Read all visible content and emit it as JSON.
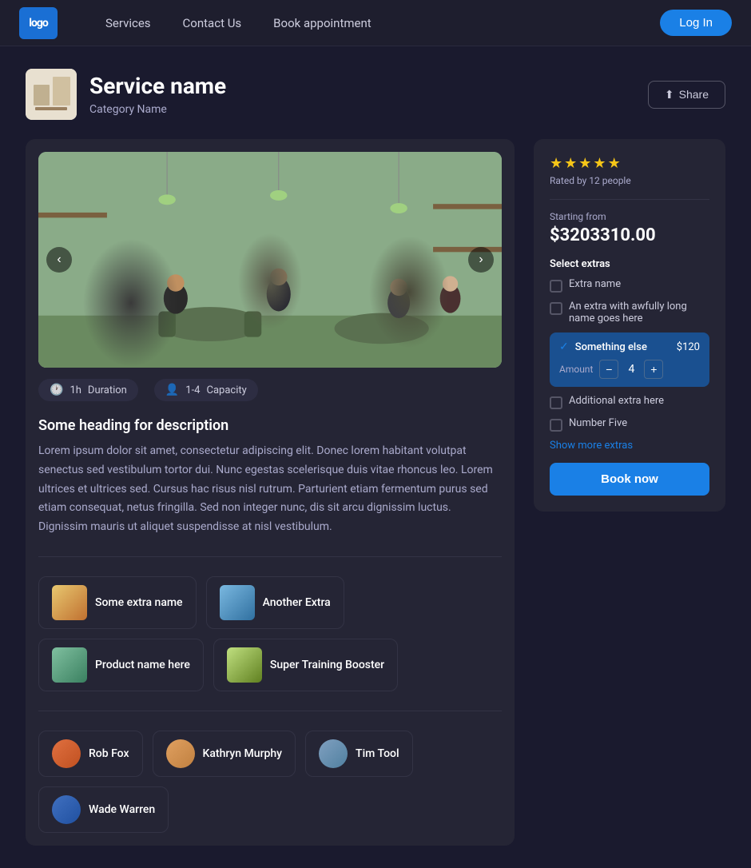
{
  "nav": {
    "logo": "logo",
    "links": [
      {
        "label": "Services",
        "id": "services"
      },
      {
        "label": "Contact Us",
        "id": "contact"
      },
      {
        "label": "Book appointment",
        "id": "book"
      }
    ],
    "login_label": "Log In"
  },
  "service": {
    "name": "Service name",
    "category": "Category Name",
    "share_label": "Share"
  },
  "gallery": {
    "prev_label": "‹",
    "next_label": "›"
  },
  "meta": {
    "duration": "1h",
    "duration_label": "Duration",
    "capacity": "1-4",
    "capacity_label": "Capacity"
  },
  "description": {
    "heading": "Some heading for description",
    "body": "Lorem ipsum dolor sit amet, consectetur adipiscing elit. Donec lorem habitant volutpat senectus sed vestibulum tortor dui. Nunc egestas scelerisque duis vitae rhoncus leo. Lorem ultrices et ultrices sed. Cursus hac risus nisl rutrum. Parturient etiam fermentum purus sed etiam consequat, netus fringilla. Sed non integer nunc, dis sit arcu dignissim luctus. Dignissim mauris ut aliquet suspendisse at nisl vestibulum."
  },
  "products": [
    {
      "id": "p1",
      "name": "Some extra name",
      "img_class": "product-img-1"
    },
    {
      "id": "p2",
      "name": "Another Extra",
      "img_class": "product-img-2"
    },
    {
      "id": "p3",
      "name": "Product name here",
      "img_class": "product-img-3"
    },
    {
      "id": "p4",
      "name": "Super Training Booster",
      "img_class": "product-img-4"
    }
  ],
  "team": [
    {
      "id": "t1",
      "name": "Rob Fox",
      "avatar_class": "avatar-1"
    },
    {
      "id": "t2",
      "name": "Kathryn Murphy",
      "avatar_class": "avatar-2"
    },
    {
      "id": "t3",
      "name": "Tim Tool",
      "avatar_class": "avatar-3"
    },
    {
      "id": "t4",
      "name": "Wade Warren",
      "avatar_class": "avatar-4"
    }
  ],
  "booking": {
    "rating_stars": 5,
    "rating_text": "Rated by 12 people",
    "starting_from_label": "Starting from",
    "price": "$3203310.00",
    "select_extras_label": "Select extras",
    "extras": [
      {
        "id": "e1",
        "name": "Extra name",
        "price": null,
        "checked": false
      },
      {
        "id": "e2",
        "name": "An extra with awfully long name goes here",
        "price": null,
        "checked": false
      },
      {
        "id": "e3",
        "name": "Something else",
        "price": "$120",
        "checked": true,
        "amount": 4
      },
      {
        "id": "e4",
        "name": "Additional extra here",
        "price": null,
        "checked": false
      },
      {
        "id": "e5",
        "name": "Number Five",
        "price": null,
        "checked": false
      }
    ],
    "show_more_label": "Show more extras",
    "book_now_label": "Book now",
    "amount_label": "Amount"
  }
}
